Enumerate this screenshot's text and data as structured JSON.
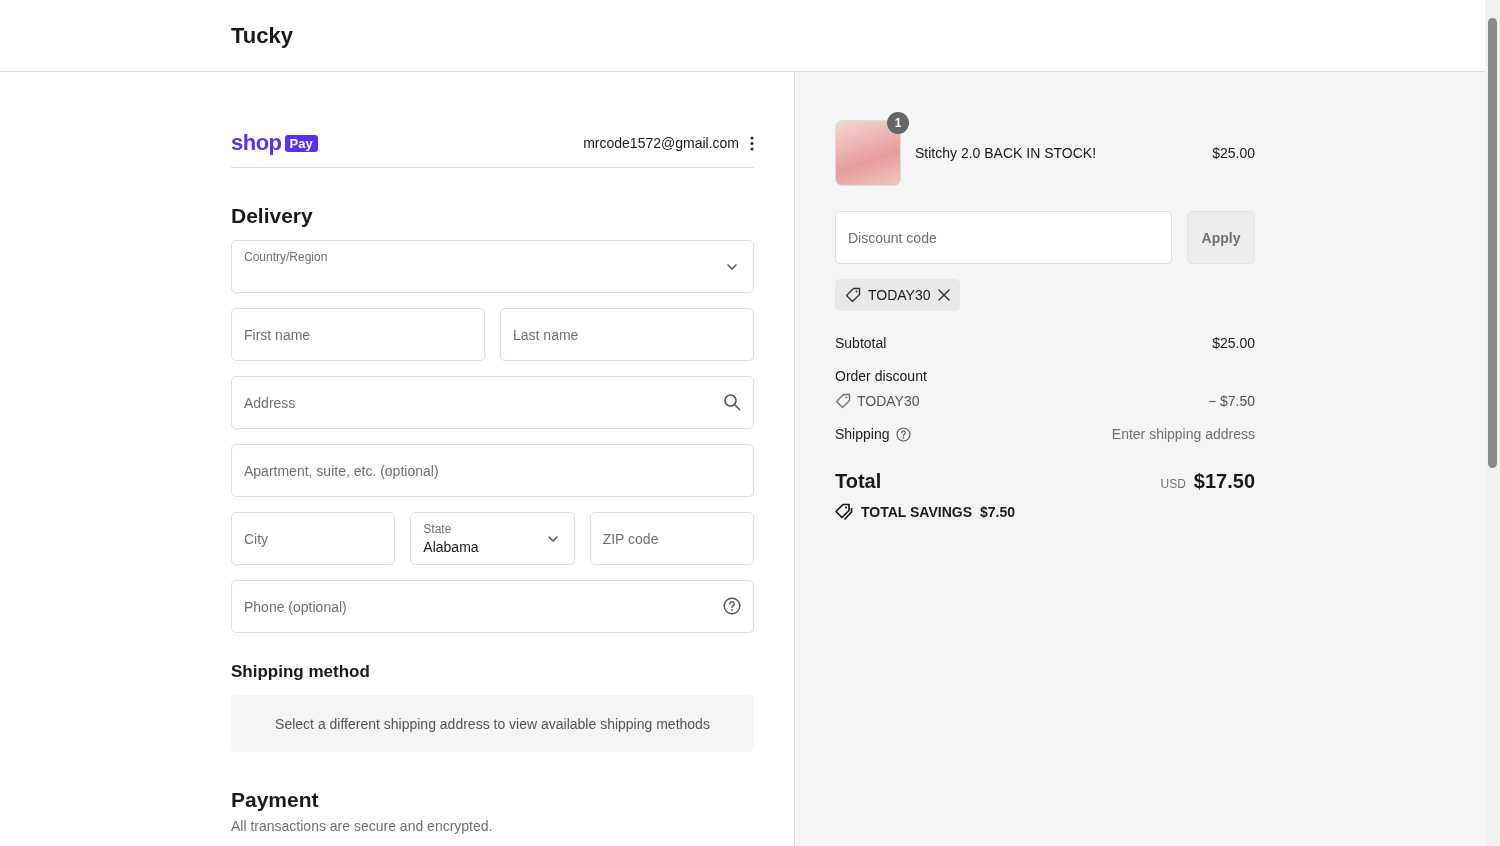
{
  "header": {
    "store_name": "Tucky"
  },
  "account": {
    "logo_word": "shop",
    "logo_badge": "Pay",
    "email": "mrcode1572@gmail.com"
  },
  "delivery": {
    "title": "Delivery",
    "rows": [
      [
        {
          "kind": "select",
          "label": "Country/Region"
        }
      ],
      [
        {
          "kind": "input",
          "placeholder": "First name"
        },
        {
          "kind": "input",
          "placeholder": "Last name"
        }
      ],
      [
        {
          "kind": "search",
          "placeholder": "Address"
        }
      ],
      [
        {
          "kind": "input",
          "placeholder": "Apartment, suite, etc. (optional)"
        }
      ],
      [
        {
          "kind": "input",
          "placeholder": "City"
        },
        {
          "kind": "select",
          "label": "State",
          "value": "Alabama"
        },
        {
          "kind": "input",
          "placeholder": "ZIP code"
        }
      ],
      [
        {
          "kind": "help",
          "placeholder": "Phone (optional)"
        }
      ]
    ]
  },
  "shipping_method": {
    "title": "Shipping method",
    "notice": "Select a different shipping address to view available shipping methods"
  },
  "payment": {
    "title": "Payment",
    "subtitle": "All transactions are secure and encrypted."
  },
  "order": {
    "items": [
      {
        "name": "Stitchy 2.0 BACK IN STOCK!",
        "price": "$25.00",
        "quantity": "1"
      }
    ],
    "discount": {
      "placeholder": "Discount code",
      "button": "Apply",
      "disabled": true,
      "applied": [
        {
          "code": "TODAY30"
        }
      ]
    },
    "lines": [
      {
        "kind": "amount",
        "label": "Subtotal",
        "value": "$25.00"
      },
      {
        "kind": "discount",
        "label": "Order discount",
        "code": "TODAY30",
        "value": "− $7.50"
      },
      {
        "kind": "shipping",
        "label": "Shipping",
        "value": "Enter shipping address"
      }
    ],
    "total": {
      "label": "Total",
      "currency": "USD",
      "amount": "$17.50"
    },
    "savings": {
      "label": "TOTAL SAVINGS",
      "amount": "$7.50"
    }
  }
}
